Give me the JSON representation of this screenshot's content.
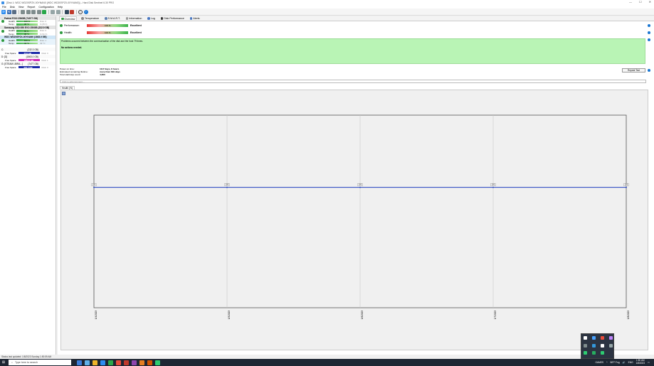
{
  "window": {
    "title": "[Disk 1: WDC WD20SPZX-00YNAN0 (WDC WD20SPZX-00YNAN0)] – Hard Disk Sentinel 6.30 PRO",
    "controls": [
      "—",
      "☐",
      "✕"
    ]
  },
  "menu": [
    "File",
    "Disk",
    "View",
    "Report",
    "Configuration",
    "Help"
  ],
  "toolbar": {
    "icons": [
      "refresh-icon",
      "rescan-icon",
      "save-icon",
      "send-icon",
      "print-icon",
      "config-icon",
      "alerts-icon",
      "test-icon",
      "report-icon",
      "copy-icon",
      "disk-icon",
      "backup-icon",
      "info-icon",
      "help-icon"
    ]
  },
  "sidebar": {
    "drives": [
      {
        "name": "Patriot P210 256GB (74077 GB)",
        "health": "100 %",
        "health_extra": "Disk: 0",
        "temp": "38 °C",
        "temp_extra": "0 (25 h)",
        "selected": false
      },
      {
        "name": "Samsung SSD 850 EVO 250GB (232.9 GB)",
        "health": "96 %",
        "health_extra": "Disk: 0",
        "temp": "38 °C",
        "temp_extra": "0 (31 h)",
        "selected": false
      },
      {
        "name": "WDC WD20SPZX-00YNAN0 (1863.0 GB)",
        "health": "100 %",
        "health_extra": "Disk: 1",
        "temp": "44 °C",
        "temp_extra": "49 °C",
        "selected": true
      }
    ],
    "volumes": [
      {
        "name": "C:",
        "size": "(232.3 GB)",
        "free_label": "Free Space",
        "free": "45.6 GB",
        "disk": "Disk: 0",
        "color": "#1c2aa8"
      },
      {
        "name": "D: [D]",
        "size": "(1863.0 GB)",
        "free_label": "Free Space",
        "free": "1863.0 GB",
        "disk": "Disk: 1",
        "color": "#d12bb3"
      },
      {
        "name": "G: [STEAM LIBRA...]",
        "size": "(7477 GB)",
        "free_label": "Free Space",
        "free": "681.4 GB",
        "disk": "Disk: 0",
        "color": "#1c2aa8"
      }
    ],
    "health_label": "Health:",
    "temp_label": "Temp.:"
  },
  "tabs": [
    "Overview",
    "Temperature",
    "S.M.A.R.T.",
    "Information",
    "Log",
    "Disk Performance",
    "Alerts"
  ],
  "overview": {
    "performance_label": "Performance:",
    "performance_value": "100 %",
    "performance_status": "Excellent",
    "health_label": "Health:",
    "health_value": "100 %",
    "health_status": "Excellent",
    "message": "Problems occurred between the communication of the disk and the host 79 times.",
    "action": "No actions needed.",
    "stats": [
      {
        "k": "Power on time:",
        "v": "1117 days, 8 hours"
      },
      {
        "k": "Estimated remaining lifetime:",
        "v": "more than 649 days"
      },
      {
        "k": "Total start/stop count:",
        "v": "4,660"
      }
    ],
    "repeat_button": "Repeat Test",
    "comment_placeholder": "Click to add comment ...",
    "subtab": "Health (%)"
  },
  "chart_data": {
    "type": "line",
    "title": "",
    "x": [
      "1/4/2023",
      "1/5/2023",
      "1/6/2023",
      "1/7/2023",
      "1/8/2023"
    ],
    "series": [
      {
        "values": [
          100,
          100,
          100,
          100,
          100
        ]
      }
    ],
    "data_labels": [
      "100",
      "100",
      "100",
      "100",
      "100"
    ],
    "ylim": [
      0,
      160
    ],
    "grid": true,
    "line_color": "#1f3fbf"
  },
  "statusbar": "Status last updated: 1/8/2023 Sunday 1:50:59 AM",
  "taskbar": {
    "search": "Type here to search",
    "weather": "58°F Fog",
    "market": "GAMES",
    "time": "1:50 AM",
    "date": "1/8/2023",
    "lang": "ENG",
    "apps": [
      "#3b7bd8",
      "#5fb0e8",
      "#f0b429",
      "#2d8cf0",
      "#2aa84a",
      "#e74c3c",
      "#c0392b",
      "#8e44ad",
      "#e67e22",
      "#d35400",
      "#2ecc71"
    ]
  },
  "tray_popup": [
    "#ffffff",
    "#4aa3ff",
    "#e74c3c",
    "#c084fc",
    "#7f8c8d",
    "#3498db",
    "#ffffff",
    "#95a5a6",
    "#2ecc71",
    "#27ae60",
    "#2ecc71"
  ]
}
